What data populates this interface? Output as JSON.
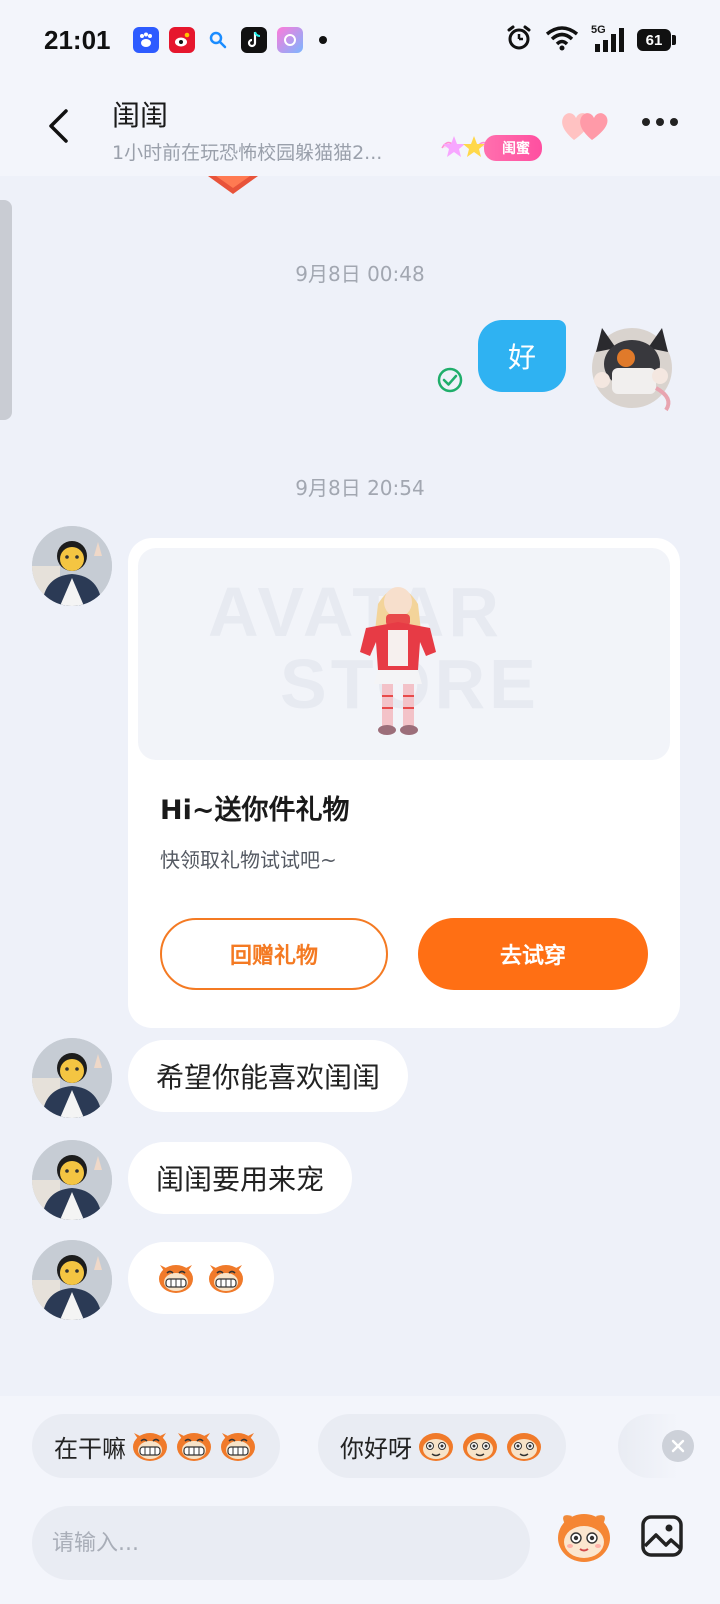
{
  "status_bar": {
    "time": "21:01",
    "network": "5G",
    "battery": "61",
    "app_icons": [
      "baidu-icon",
      "weibo-icon",
      "search-app-icon",
      "tiktok-icon",
      "app-icon",
      "dot-icon"
    ]
  },
  "header": {
    "title": "闺闺",
    "subtitle": "1小时前在玩恐怖校园躲猫猫2...",
    "badge": "闺蜜"
  },
  "messages": {
    "ts1": "9月8日 00:48",
    "me_text": "好",
    "ts2": "9月8日 20:54",
    "gift_card": {
      "title": "Hi~送你件礼物",
      "desc": "快领取礼物试试吧~",
      "store_line1": "AVATAR",
      "store_line2": "STORE",
      "btn_return": "回赠礼物",
      "btn_try": "去试穿"
    },
    "text1": "希望你能喜欢闺闺",
    "text2": "闺闺要用来宠",
    "emoji_count": 2
  },
  "quick_replies": [
    {
      "text": "在干嘛",
      "emoji_count": 3
    },
    {
      "text": "你好呀",
      "emoji_count": 3
    }
  ],
  "input": {
    "placeholder": "请输入..."
  },
  "colors": {
    "accent_orange": "#ff6f14",
    "bubble_blue": "#2fb2f2",
    "badge_pink": "#ff4fa0",
    "read_green": "#1fae6b"
  }
}
